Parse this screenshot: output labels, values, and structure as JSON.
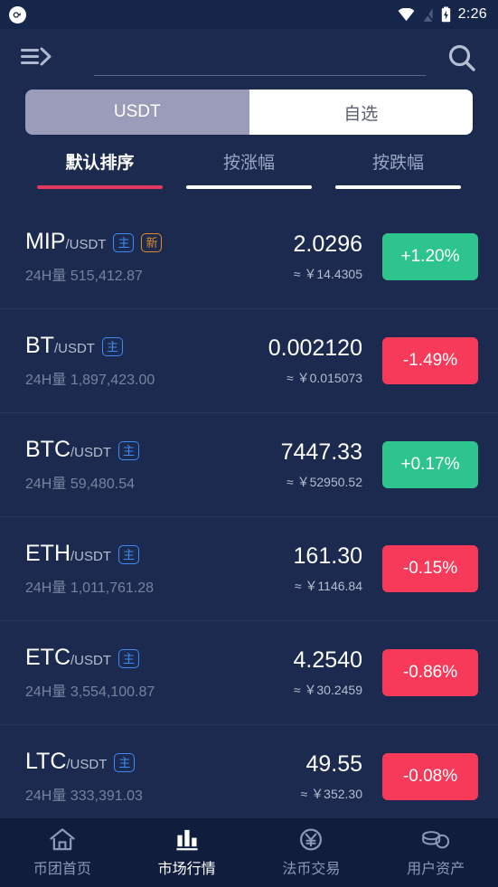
{
  "status_bar": {
    "notification_icon": "app-notification-icon",
    "wifi_icon": "wifi-icon",
    "signal_off_icon": "signal-off-icon",
    "battery_icon": "battery-charging-icon",
    "time": "2:26"
  },
  "top_bar": {
    "menu_icon": "menu-arrow-icon",
    "search_icon": "search-icon",
    "search_value": "",
    "search_placeholder": ""
  },
  "market_tabs": [
    {
      "label": "USDT",
      "active": true
    },
    {
      "label": "自选",
      "active": false
    }
  ],
  "sort_tabs": [
    {
      "label": "默认排序",
      "active": true
    },
    {
      "label": "按涨幅",
      "active": false
    },
    {
      "label": "按跌幅",
      "active": false
    }
  ],
  "colors": {
    "background": "#1b2a4e",
    "up": "#2ec48d",
    "down": "#f83a5a",
    "active_underline": "#e43a5e",
    "tag_main": "#3d8bf2",
    "tag_new": "#e08a2a"
  },
  "coins": [
    {
      "symbol": "MIP",
      "quote": "/USDT",
      "tags": [
        "主",
        "新"
      ],
      "volume_label": "24H量",
      "volume": "515,412.87",
      "price": "2.0296",
      "cny": "≈ ￥14.4305",
      "change": "+1.20%",
      "direction": "up"
    },
    {
      "symbol": "BT",
      "quote": "/USDT",
      "tags": [
        "主"
      ],
      "volume_label": "24H量",
      "volume": "1,897,423.00",
      "price": "0.002120",
      "cny": "≈ ￥0.015073",
      "change": "-1.49%",
      "direction": "down"
    },
    {
      "symbol": "BTC",
      "quote": "/USDT",
      "tags": [
        "主"
      ],
      "volume_label": "24H量",
      "volume": "59,480.54",
      "price": "7447.33",
      "cny": "≈ ￥52950.52",
      "change": "+0.17%",
      "direction": "up"
    },
    {
      "symbol": "ETH",
      "quote": "/USDT",
      "tags": [
        "主"
      ],
      "volume_label": "24H量",
      "volume": "1,011,761.28",
      "price": "161.30",
      "cny": "≈ ￥1146.84",
      "change": "-0.15%",
      "direction": "down"
    },
    {
      "symbol": "ETC",
      "quote": "/USDT",
      "tags": [
        "主"
      ],
      "volume_label": "24H量",
      "volume": "3,554,100.87",
      "price": "4.2540",
      "cny": "≈ ￥30.2459",
      "change": "-0.86%",
      "direction": "down"
    },
    {
      "symbol": "LTC",
      "quote": "/USDT",
      "tags": [
        "主"
      ],
      "volume_label": "24H量",
      "volume": "333,391.03",
      "price": "49.55",
      "cny": "≈ ￥352.30",
      "change": "-0.08%",
      "direction": "down"
    }
  ],
  "bottom_nav": [
    {
      "label": "币团首页",
      "icon": "home-icon",
      "active": false
    },
    {
      "label": "市场行情",
      "icon": "bar-chart-icon",
      "active": true
    },
    {
      "label": "法币交易",
      "icon": "yen-circle-icon",
      "active": false
    },
    {
      "label": "用户资产",
      "icon": "coins-icon",
      "active": false
    }
  ]
}
